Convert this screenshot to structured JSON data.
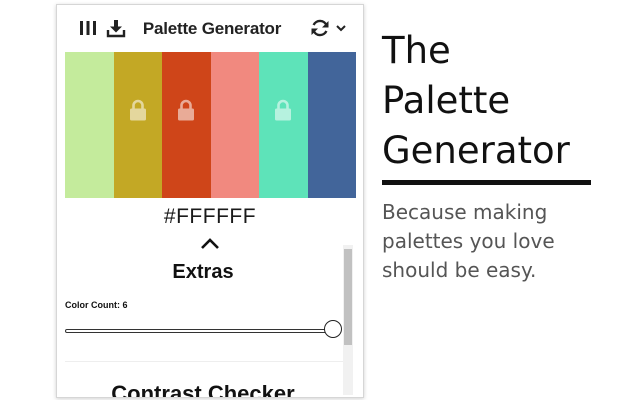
{
  "popup": {
    "title": "Palette Generator",
    "toolbar_icons": [
      "columns-icon",
      "download-icon",
      "refresh-icon",
      "chevron-down-icon"
    ],
    "swatches": [
      {
        "color": "#c4eb9c",
        "locked": false
      },
      {
        "color": "#c3a825",
        "locked": true
      },
      {
        "color": "#cf4519",
        "locked": true
      },
      {
        "color": "#f1897f",
        "locked": false
      },
      {
        "color": "#5ee3b9",
        "locked": true
      },
      {
        "color": "#42659a",
        "locked": false
      }
    ],
    "selected_hex": "#FFFFFF",
    "extras_title": "Extras",
    "color_count_label": "Color Count: 6",
    "color_count": {
      "value": 6,
      "min": 1,
      "max": 6
    },
    "next_section_title": "Contrast Checker"
  },
  "promo": {
    "title_lines": [
      "The",
      "Palette",
      "Generator"
    ],
    "subtitle_lines": [
      "Because making",
      "palettes you love",
      "should be easy."
    ]
  }
}
